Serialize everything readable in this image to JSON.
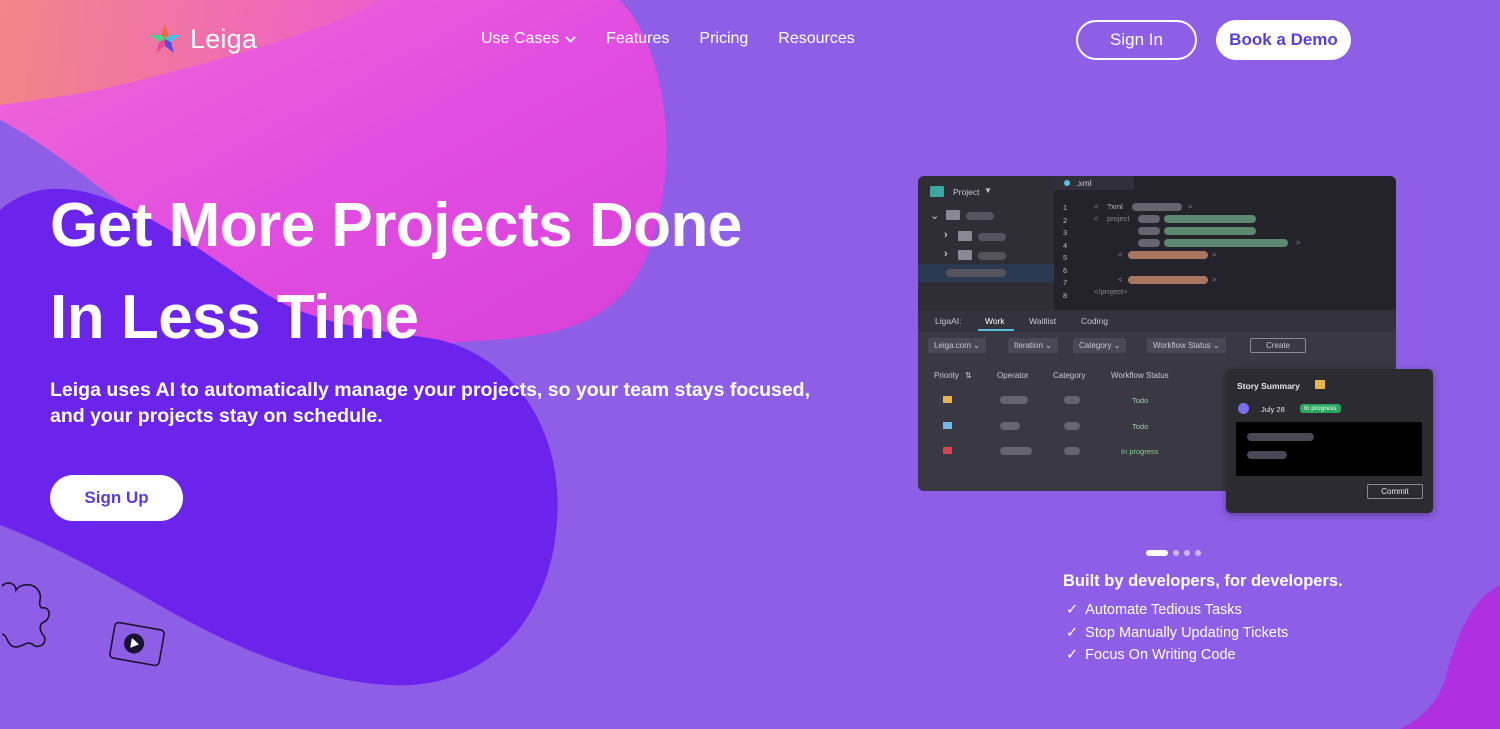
{
  "nav": {
    "brand": "Leiga",
    "menu": [
      {
        "label": "Use Cases",
        "has_dropdown": true
      },
      {
        "label": "Features"
      },
      {
        "label": "Pricing"
      },
      {
        "label": "Resources"
      }
    ],
    "sign_in": "Sign In",
    "book_demo": "Book a Demo"
  },
  "hero": {
    "title_line1": "Get More Projects Done",
    "title_line2": "In Less Time",
    "subtitle": "Leiga uses AI to automatically manage your projects, so your team stays focused, and your projects stay on schedule.",
    "cta": "Sign Up"
  },
  "mockup": {
    "sidebar_title": "Project",
    "file_tab": ".xml",
    "line_numbers": [
      "1",
      "2",
      "3",
      "4",
      "5",
      "6",
      "7",
      "8"
    ],
    "code_xml_decl": "?xml",
    "code_open_tag": "project",
    "code_close_tag": "</project>",
    "tabs": [
      "LigaAI:",
      "Work",
      "Waitlist",
      "Coding"
    ],
    "active_tab": "Work",
    "filters": [
      "Leiga.com",
      "Iteration",
      "Category",
      "Workflow Status"
    ],
    "create_label": "Create",
    "columns": [
      "Priority",
      "Operator",
      "Category",
      "Workflow Status"
    ],
    "rows": [
      {
        "flag_color": "#e8b54d",
        "status": "Todo"
      },
      {
        "flag_color": "#6fb8e8",
        "status": "Todo"
      },
      {
        "flag_color": "#d9434a",
        "status": "In progress"
      }
    ],
    "story": {
      "title": "Story Summary",
      "date": "July 28",
      "badge": "In progress",
      "commit": "Commit"
    }
  },
  "features": {
    "slider_count": 4,
    "active_slide": 1,
    "title": "Built by developers, for developers.",
    "items": [
      "Automate Tedious Tasks",
      "Stop Manually Updating Tickets",
      "Focus On Writing Code"
    ]
  },
  "colors": {
    "background": "#8e5fe6",
    "blob_pink": "#e64fd6",
    "blob_violet": "#6a24ec",
    "accent": "#5a3ed6"
  }
}
